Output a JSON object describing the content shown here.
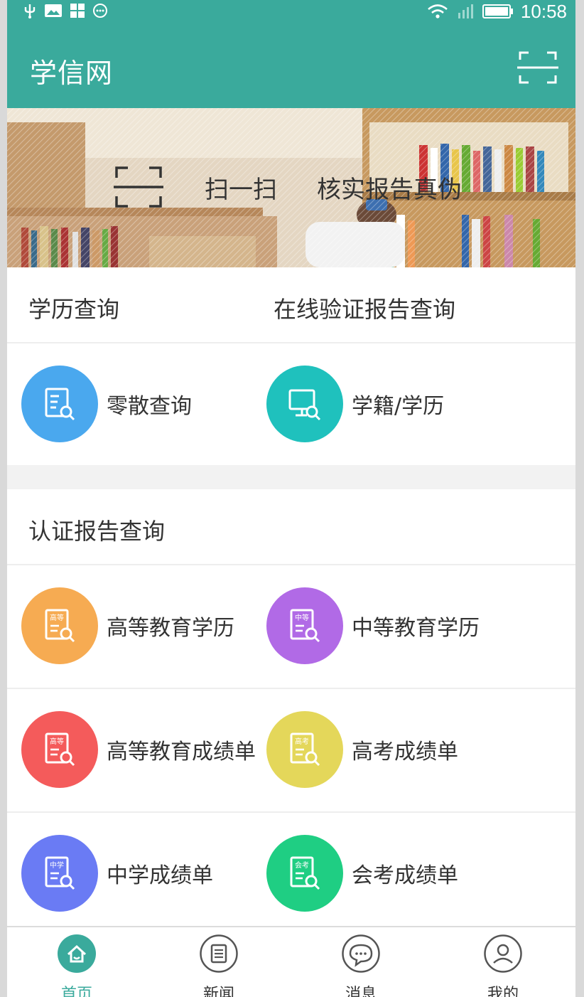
{
  "status_bar": {
    "time": "10:58"
  },
  "header": {
    "title": "学信网"
  },
  "banner": {
    "scan_text": "扫一扫",
    "verify_text": "核实报告真伪"
  },
  "section1": {
    "title_left": "学历查询",
    "title_right": "在线验证报告查询",
    "items": [
      {
        "label": "零散查询",
        "color": "#4aa8ee"
      },
      {
        "label": "学籍/学历",
        "color": "#1fc1bd"
      }
    ]
  },
  "section2": {
    "title": "认证报告查询",
    "items": [
      {
        "label": "高等教育学历",
        "badge": "高等",
        "color": "#f6ab52"
      },
      {
        "label": "中等教育学历",
        "badge": "中等",
        "color": "#b16ae6"
      },
      {
        "label": "高等教育成绩单",
        "badge": "高等",
        "color": "#f45b5b"
      },
      {
        "label": "高考成绩单",
        "badge": "高考",
        "color": "#e4d75a"
      },
      {
        "label": "中学成绩单",
        "badge": "中学",
        "color": "#6a7bf4"
      },
      {
        "label": "会考成绩单",
        "badge": "会考",
        "color": "#1fce83"
      }
    ]
  },
  "tabbar": {
    "tabs": [
      {
        "label": "首页",
        "icon": "home-icon"
      },
      {
        "label": "新闻",
        "icon": "news-icon"
      },
      {
        "label": "消息",
        "icon": "message-icon"
      },
      {
        "label": "我的",
        "icon": "profile-icon"
      }
    ]
  },
  "colors": {
    "primary": "#3aaa9c"
  }
}
